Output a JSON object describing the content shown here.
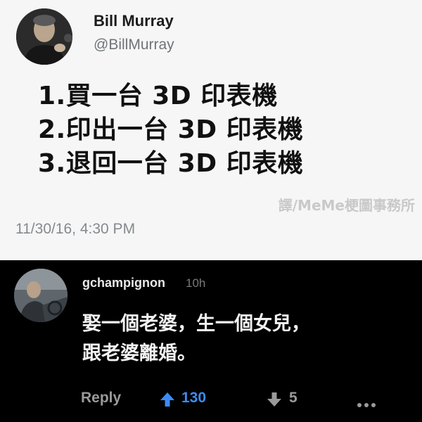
{
  "tweet": {
    "author_name": "Bill Murray",
    "author_handle": "@BillMurray",
    "lines": [
      "1.買一台 3D 印表機",
      "2.印出一台 3D 印表機",
      "3.退回一台 3D 印表機"
    ],
    "timestamp": "11/30/16, 4:30 PM"
  },
  "watermark": "譯/MeMe梗圖事務所",
  "comment": {
    "username": "gchampignon",
    "time_ago": "10h",
    "lines": [
      "娶一個老婆，生一個女兒，",
      "跟老婆離婚。"
    ],
    "reply_label": "Reply",
    "upvotes": "130",
    "downvotes": "5"
  },
  "icons": {
    "upvote": "arrow-up-icon",
    "downvote": "arrow-down-icon",
    "more": "more-dots-icon"
  },
  "colors": {
    "tweet_background": "#f6f6f6",
    "comment_background": "#000000",
    "upvote_accent": "#3d8bf2"
  }
}
